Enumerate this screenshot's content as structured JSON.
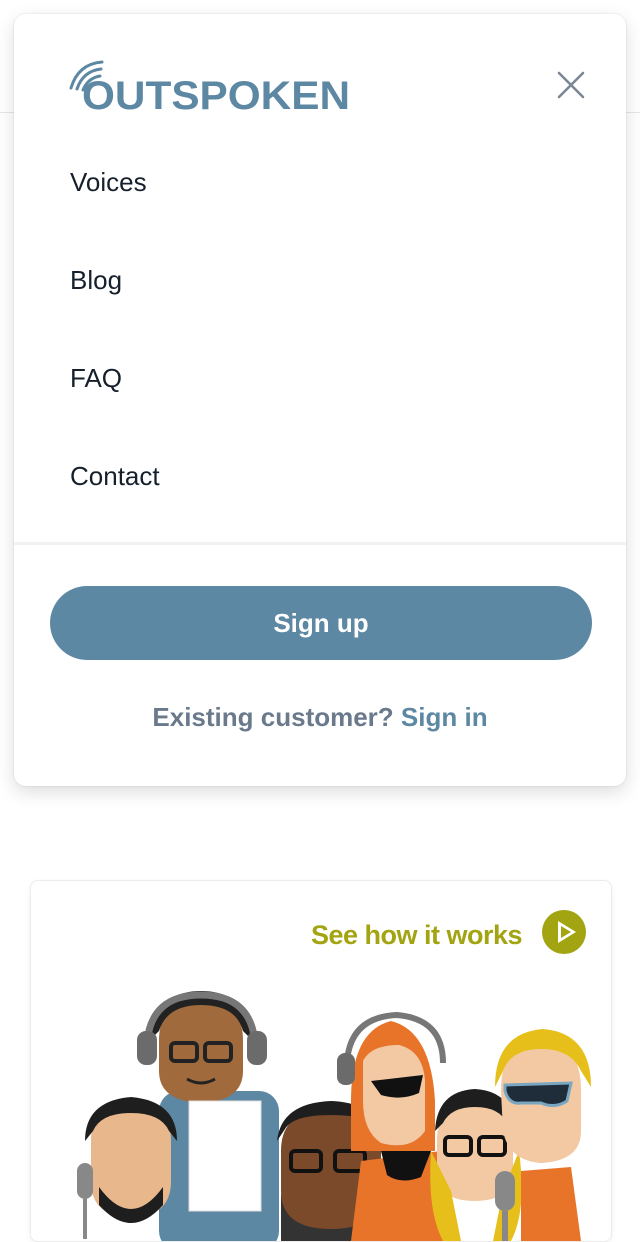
{
  "brand": {
    "logo_text": "OUTSPOKEN"
  },
  "menu": {
    "items": [
      {
        "label": "Voices"
      },
      {
        "label": "Blog"
      },
      {
        "label": "FAQ"
      },
      {
        "label": "Contact"
      }
    ],
    "signup_label": "Sign up",
    "existing_text": "Existing customer?",
    "signin_label": "Sign in"
  },
  "card": {
    "cta_label": "See how it works"
  },
  "icons": {
    "close": "close-icon",
    "play": "play-icon"
  },
  "colors": {
    "accent": "#5d88a3",
    "text": "#16202c",
    "muted": "#6a7a8c",
    "cta": "#a3a411"
  }
}
